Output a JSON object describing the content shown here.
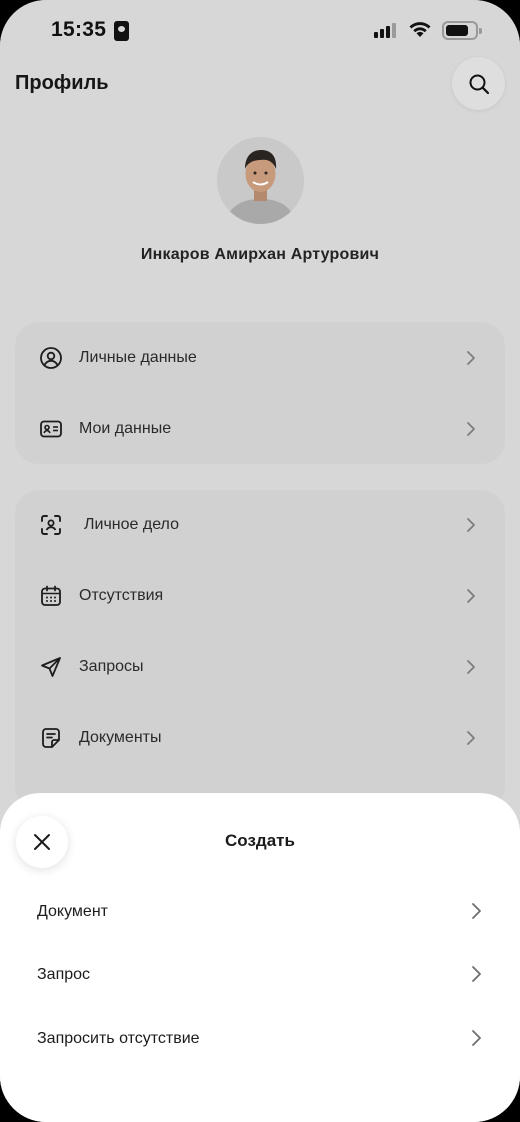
{
  "status_bar": {
    "time": "15:35"
  },
  "header": {
    "title": "Профиль"
  },
  "profile": {
    "name": "Инкаров Амирхан Артурович"
  },
  "menu_group_1": [
    {
      "label": "Личные данные",
      "icon": "user-circle-icon"
    },
    {
      "label": "Мои данные",
      "icon": "id-card-icon"
    }
  ],
  "menu_group_2": [
    {
      "label": "Личное дело",
      "icon": "face-scan-icon"
    },
    {
      "label": "Отсутствия",
      "icon": "calendar-icon"
    },
    {
      "label": "Запросы",
      "icon": "send-icon"
    },
    {
      "label": "Документы",
      "icon": "document-icon"
    }
  ],
  "sheet": {
    "title": "Создать",
    "items": [
      {
        "label": "Документ"
      },
      {
        "label": "Запрос"
      },
      {
        "label": "Запросить отсутствие"
      }
    ]
  }
}
